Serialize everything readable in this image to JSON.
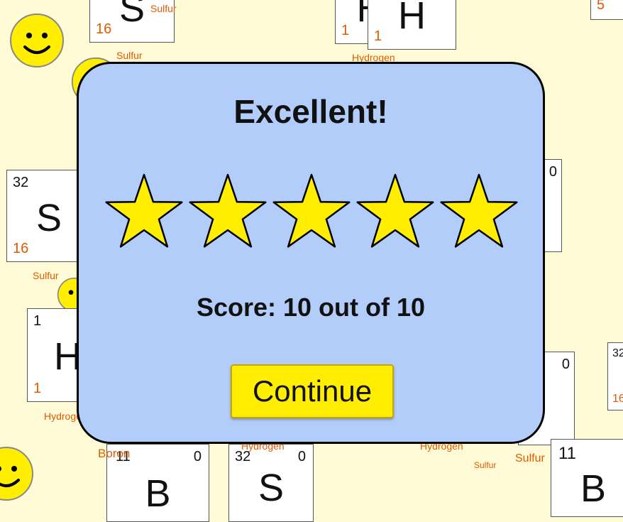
{
  "background": {
    "tiles": [
      {
        "id": "t1",
        "symbol": "S",
        "mass": "",
        "number": "16",
        "charge": "",
        "label": "Sulfur"
      },
      {
        "id": "t2",
        "symbol": "H",
        "mass": "",
        "number": "1",
        "charge": "",
        "label": ""
      },
      {
        "id": "t3",
        "symbol": "H",
        "mass": "",
        "number": "1",
        "charge": "",
        "label": "Hydrogen"
      },
      {
        "id": "t4",
        "symbol": "",
        "mass": "",
        "number": "5",
        "charge": "",
        "label": ""
      },
      {
        "id": "t5",
        "symbol": "S",
        "mass": "32",
        "number": "16",
        "charge": "",
        "label": "Sulfur"
      },
      {
        "id": "t6",
        "symbol": "H",
        "mass": "1",
        "number": "1",
        "charge": "",
        "label": "Hydrogen"
      },
      {
        "id": "t7",
        "symbol": "",
        "mass": "",
        "number": "",
        "charge": "0",
        "label": ""
      },
      {
        "id": "t8",
        "symbol": "",
        "mass": "",
        "number": "",
        "charge": "0",
        "label": ""
      },
      {
        "id": "t9",
        "symbol": "",
        "mass": "32",
        "number": "16",
        "charge": "",
        "label": ""
      },
      {
        "id": "t10",
        "symbol": "B",
        "mass": "11",
        "number": "",
        "charge": "0",
        "label": "Boron"
      },
      {
        "id": "t11",
        "symbol": "S",
        "mass": "32",
        "number": "",
        "charge": "0",
        "label": "Hydrogen"
      },
      {
        "id": "t12",
        "symbol": "B",
        "mass": "11",
        "number": "",
        "charge": "",
        "label": "Sulfur"
      }
    ],
    "extra_labels": [
      "Sulfur",
      "Hydrogen",
      "Sulfur"
    ]
  },
  "modal": {
    "title": "Excellent!",
    "rating": {
      "value": 5,
      "max": 5
    },
    "score_text": "Score: 10 out of 10",
    "continue_label": "Continue"
  },
  "colors": {
    "background": "#fffbd6",
    "modal_bg": "#b3cdfa",
    "star_fill": "#ffee00",
    "button_bg": "#ffee00",
    "element_number": "#e05a00",
    "smiley": "#ffee00"
  }
}
